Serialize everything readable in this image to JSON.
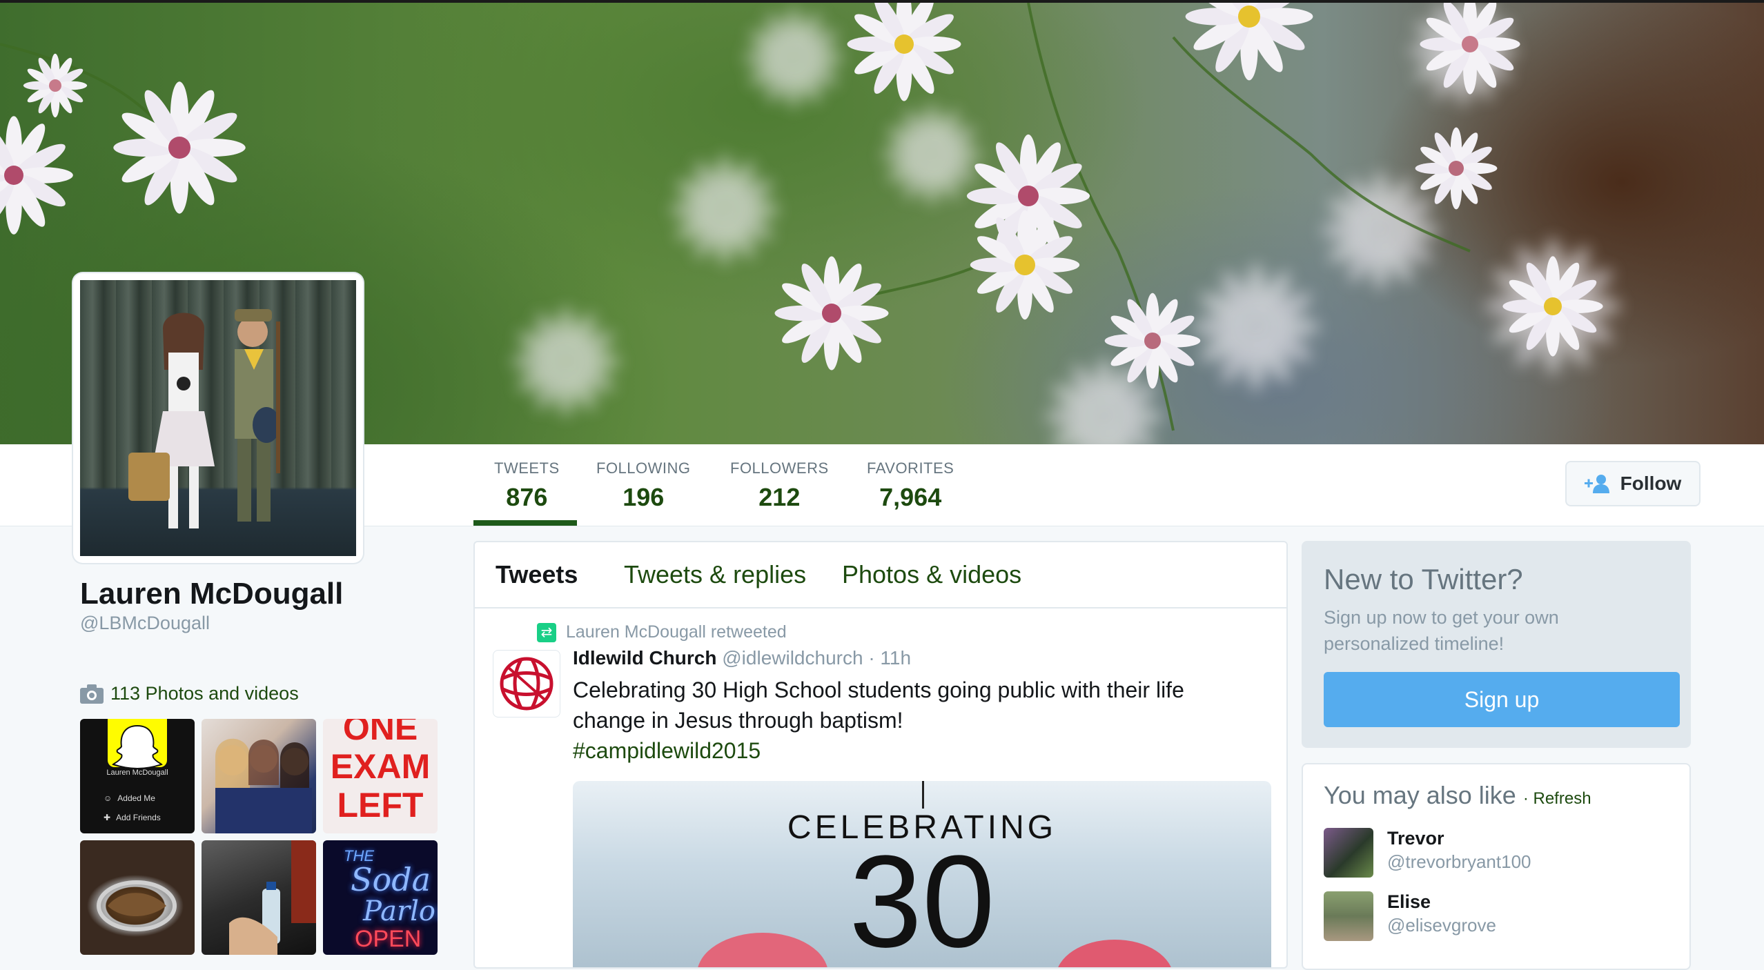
{
  "profile": {
    "name": "Lauren McDougall",
    "handle": "@LBMcDougall",
    "photos_link": "113 Photos and videos"
  },
  "stats": [
    {
      "label": "TWEETS",
      "value": "876"
    },
    {
      "label": "FOLLOWING",
      "value": "196"
    },
    {
      "label": "FOLLOWERS",
      "value": "212"
    },
    {
      "label": "FAVORITES",
      "value": "7,964"
    }
  ],
  "follow_button": {
    "label": "Follow",
    "icon": "add-user-icon"
  },
  "tabs": [
    {
      "label": "Tweets",
      "active": true
    },
    {
      "label": "Tweets & replies",
      "active": false
    },
    {
      "label": "Photos & videos",
      "active": false
    }
  ],
  "tweet": {
    "retweet_note": "Lauren McDougall retweeted",
    "author_name": "Idlewild Church",
    "author_meta": "@idlewildchurch · 11h",
    "text_line1": "Celebrating 30 High School students going public with their life",
    "text_line2": "change in Jesus through baptism!",
    "hashtag": "#campidlewild2015",
    "media_text1": "CELEBRATING",
    "media_text2": "30"
  },
  "thumbnails": {
    "snapchat_name": "Lauren McDougall",
    "snapchat_added": "Added Me",
    "snapchat_friends": "Add Friends",
    "exam_text": [
      "ONE",
      "EXAM",
      "LEFT"
    ],
    "neon_text": [
      "THE",
      "Soda",
      "Parlor"
    ],
    "neon_open": "OPEN"
  },
  "signup": {
    "title": "New to Twitter?",
    "subtitle": "Sign up now to get your own personalized timeline!",
    "button": "Sign up"
  },
  "suggestions": {
    "title": "You may also like",
    "refresh": "· Refresh",
    "users": [
      {
        "name": "Trevor",
        "handle": "@trevorbryant100"
      },
      {
        "name": "Elise",
        "handle": "@elisevgrove"
      }
    ]
  },
  "colors": {
    "accent": "#1d4a0f",
    "signup_button": "#55acee",
    "retweet_green": "#19cf86"
  }
}
